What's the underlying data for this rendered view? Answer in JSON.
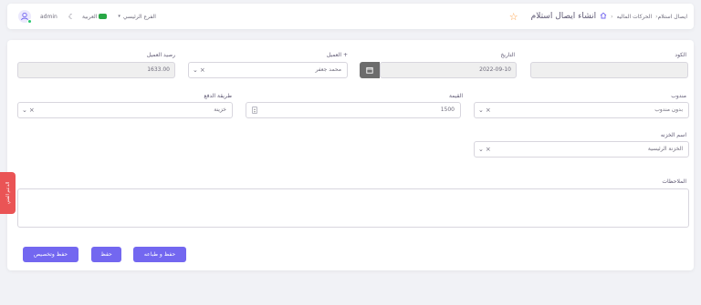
{
  "header": {
    "title": "انشاء ايصال استلام",
    "breadcrumb": {
      "section": "الحركات الماليه",
      "current": "ايصال استلام"
    },
    "branch": "الفرع الرئيسي",
    "language": "العربية",
    "user": "admin"
  },
  "form": {
    "code": {
      "label": "الكود",
      "value": ""
    },
    "date": {
      "label": "التاريخ",
      "value": "2022-09-10"
    },
    "client": {
      "label": "العميل +",
      "value": "محمد جعفر"
    },
    "balance": {
      "label": "رصيد العميل",
      "value": "1633.00"
    },
    "rep": {
      "label": "مندوب",
      "value": "بدون مندوب"
    },
    "amount": {
      "label": "القيمة",
      "value": "1500"
    },
    "payment": {
      "label": "طريقة الدفع",
      "value": "خزينة"
    },
    "treasury": {
      "label": "اسم الخزنه",
      "value": "الخزنة الرئيسية"
    },
    "notes": {
      "label": "الملاحظات",
      "value": ""
    }
  },
  "buttons": {
    "save_print": "حفظ و طباعه",
    "save": "حفظ",
    "save_allocate": "حفظ وتخصيص"
  },
  "side_tab": "الدعم الفني",
  "colors": {
    "primary": "#7367f0",
    "danger": "#ea5455",
    "online": "#28c76f"
  }
}
